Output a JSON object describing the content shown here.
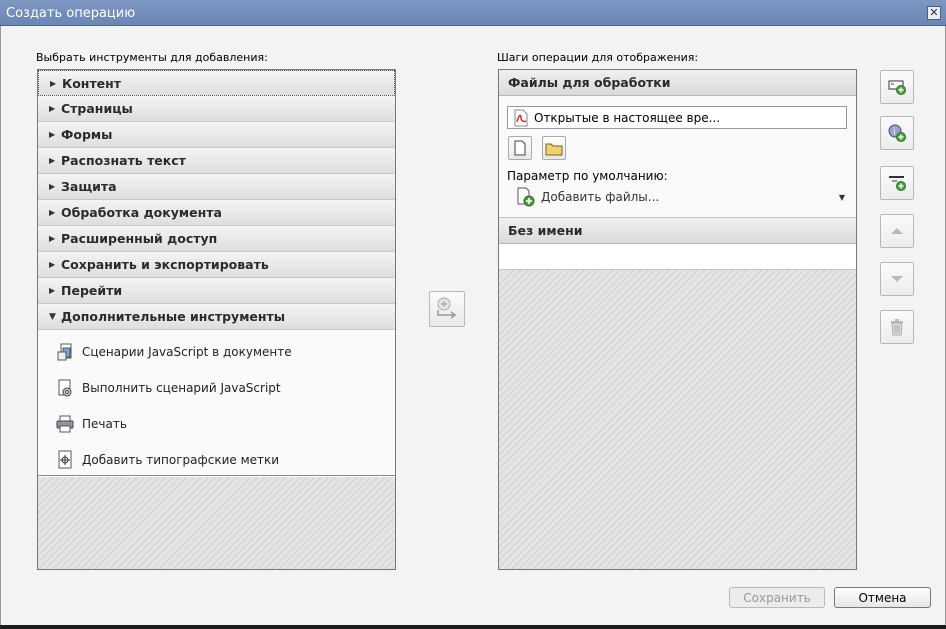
{
  "window": {
    "title": "Создать операцию",
    "close_glyph": "✕"
  },
  "left": {
    "label": "Выбрать инструменты для добавления:",
    "categories": [
      {
        "label": "Контент"
      },
      {
        "label": "Страницы"
      },
      {
        "label": "Формы"
      },
      {
        "label": "Распознать текст"
      },
      {
        "label": "Защита"
      },
      {
        "label": "Обработка документа"
      },
      {
        "label": "Расширенный доступ"
      },
      {
        "label": "Сохранить и экспортировать"
      },
      {
        "label": "Перейти"
      }
    ],
    "expanded_category": "Дополнительные инструменты",
    "tools": [
      {
        "label": "Сценарии JavaScript в документе",
        "icon": "javascript-document-icon"
      },
      {
        "label": "Выполнить сценарий JavaScript",
        "icon": "run-javascript-icon"
      },
      {
        "label": "Печать",
        "icon": "printer-icon"
      },
      {
        "label": "Добавить типографские метки",
        "icon": "printer-marks-icon"
      }
    ]
  },
  "right": {
    "label": "Шаги операции для отображения:",
    "files_section": {
      "title": "Файлы для обработки",
      "file_value": "Открытые в настоящее вре...",
      "param_label": "Параметр по умолчанию:",
      "add_files_label": "Добавить файлы..."
    },
    "unnamed_section": {
      "title": "Без имени"
    }
  },
  "buttons": {
    "save": "Сохранить",
    "cancel": "Отмена"
  },
  "colors": {
    "titlebar": "#7a93bf",
    "panel_bg": "#f3f3f3",
    "accent_green": "#4aa23a",
    "pdf_red": "#c8281e"
  }
}
